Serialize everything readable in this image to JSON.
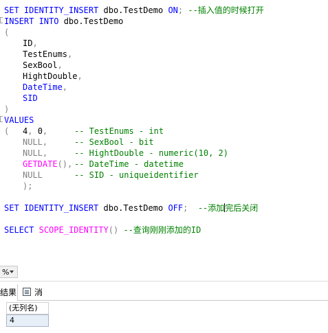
{
  "editor": {
    "line1": {
      "kw1": "SET IDENTITY_INSERT",
      "obj": " dbo.TestDemo ",
      "kw2": "ON",
      "semi": ";",
      "comment": " --插入值的时候打开"
    },
    "line2": {
      "kw1": "INSERT INTO",
      "obj": " dbo.TestDemo"
    },
    "line3": {
      "paren": "("
    },
    "line4": {
      "name": "ID",
      "comma": ","
    },
    "line5": {
      "name": "TestEnums",
      "comma": ","
    },
    "line6": {
      "name": "SexBool",
      "comma": ","
    },
    "line7": {
      "name": "HightDouble",
      "comma": ","
    },
    "line8": {
      "name": "DateTime",
      "comma": ","
    },
    "line9": {
      "name": "SID"
    },
    "line10": {
      "paren": ")"
    },
    "line11": {
      "kw": "VALUES"
    },
    "line12": {
      "paren": "(",
      "val1": "4",
      "comma1": ",",
      "val2": " 0",
      "comma2": ",",
      "comment": "-- TestEnums - int"
    },
    "line13": {
      "val": "NULL",
      "comma": ",",
      "comment": "-- SexBool - bit"
    },
    "line14": {
      "val": "NULL",
      "comma": ",",
      "comment": "-- HightDouble - numeric(10, 2)"
    },
    "line15": {
      "fn": "GETDATE",
      "parens": "()",
      "comma": ",",
      "comment": "-- DateTime - datetime"
    },
    "line16": {
      "val": "NULL",
      "comment": "-- SID - uniqueidentifier"
    },
    "line17": {
      "paren": ")",
      "semi": ";"
    },
    "line18": {
      "kw1": "SET IDENTITY_INSERT",
      "obj": " dbo.TestDemo ",
      "kw2": "OFF",
      "semi": ";",
      "comment1": "--添加",
      "comment2": "完后关闭"
    },
    "line19": {
      "kw": "SELECT",
      "fn": "SCOPE_IDENTITY",
      "parens": "()",
      "comment": "--查询刚刚添加的ID"
    }
  },
  "zoom": {
    "value": "%"
  },
  "tabs": [
    {
      "label": "结果"
    },
    {
      "label": "消息"
    }
  ],
  "results": {
    "columns": [
      "(无列名)"
    ],
    "rows": [
      [
        "4"
      ]
    ]
  },
  "colors": {
    "keyword": "#0000ff",
    "comment": "#008000",
    "function": "#ff00ff",
    "operator": "#808080",
    "column": "#008080"
  }
}
